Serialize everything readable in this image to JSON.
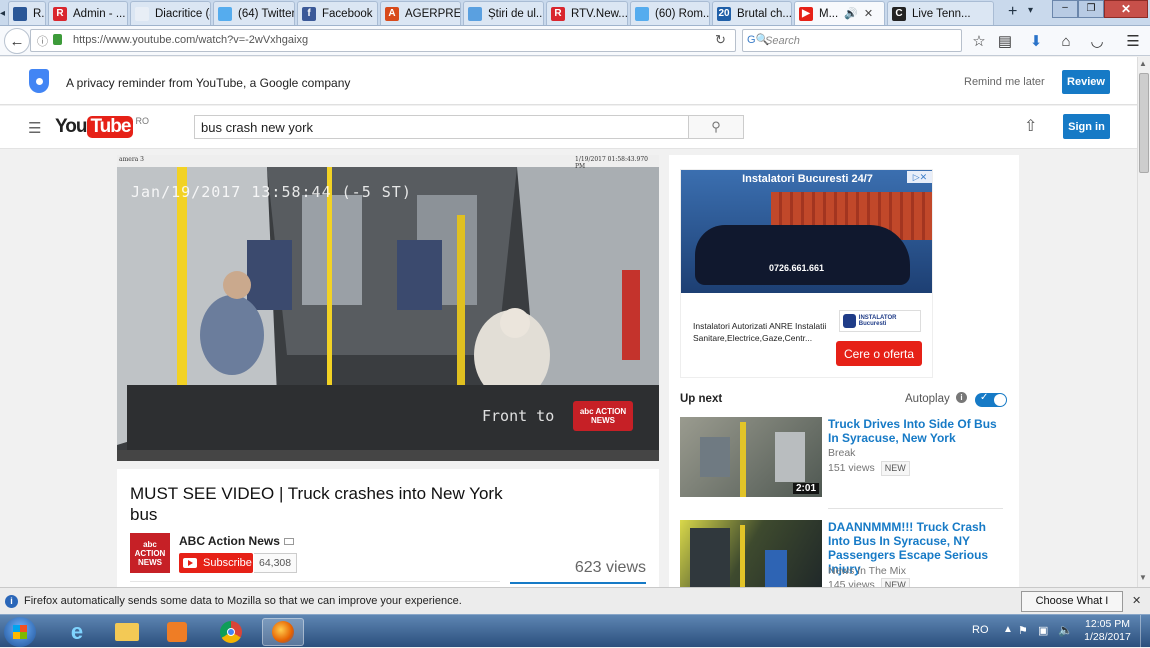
{
  "browser": {
    "tabs": [
      {
        "label": "R...",
        "icon": "generic-tab-icon",
        "color": "#2b5797",
        "glyph": ""
      },
      {
        "label": "Admin - ...",
        "icon": "admin-r-icon",
        "color": "#d9262e",
        "glyph": "R"
      },
      {
        "label": "Diacritice (ăâî...",
        "icon": "blank-page-icon",
        "color": "#e8eef6",
        "glyph": ""
      },
      {
        "label": "(64) Twitter",
        "icon": "twitter-icon",
        "color": "#55acee",
        "glyph": ""
      },
      {
        "label": "Facebook",
        "icon": "facebook-icon",
        "color": "#3b5998",
        "glyph": "f"
      },
      {
        "label": "AGERPRE...",
        "icon": "agerpres-icon",
        "color": "#d84a1b",
        "glyph": "A"
      },
      {
        "label": "Știri de ul...",
        "icon": "news-icon",
        "color": "#5aa0e0",
        "glyph": ""
      },
      {
        "label": "RTV.New...",
        "icon": "rtv-icon",
        "color": "#d9262e",
        "glyph": "R"
      },
      {
        "label": "(60) Rom...",
        "icon": "twitter-icon",
        "color": "#55acee",
        "glyph": ""
      },
      {
        "label": "Brutal ch...",
        "icon": "twenty-icon",
        "color": "#1f5fa8",
        "glyph": "20"
      },
      {
        "label": "M...",
        "icon": "youtube-tab-icon",
        "color": "#e62117",
        "glyph": "▶"
      },
      {
        "label": "Live Tenn...",
        "icon": "tennis-icon",
        "color": "#222222",
        "glyph": "C"
      }
    ],
    "url": "https://www.youtube.com/watch?v=-2wVxhgaixg",
    "search_placeholder": "Search"
  },
  "privacy": {
    "text": "A privacy reminder from YouTube, a Google company",
    "remind": "Remind me later",
    "review": "Review"
  },
  "youtube": {
    "logo_you": "You",
    "logo_tube": "Tube",
    "region": "RO",
    "search_query": "bus crash new york",
    "signin": "Sign in"
  },
  "video": {
    "overlay_time": "Jan/19/2017 13:58:44 (-5 ST)",
    "camera": "amera 3",
    "stamp": "1/19/2017 01:58:43.970 PM",
    "watermark": "Front to",
    "badge": "abc ACTION NEWS",
    "title": "MUST SEE VIDEO | Truck crashes into New York bus",
    "channel": "ABC Action News",
    "channel_logo": "abc ACTION NEWS",
    "subscribe": "Subscribe",
    "subscribers": "64,308",
    "views": "623 views"
  },
  "ad": {
    "banner_title": "Instalatori Bucuresti 24/7",
    "phone": "0726.661.661",
    "text": "Instalatori Autorizati ANRE Instalatii Sanitare,Electrice,Gaze,Centr...",
    "logo": "INSTALATOR Bucuresti",
    "cta": "Cere o oferta"
  },
  "upnext": {
    "label": "Up next",
    "autoplay": "Autoplay",
    "items": [
      {
        "title": "Truck Drives Into Side Of Bus In Syracuse, New York",
        "channel": "Break",
        "views": "151 views",
        "badge": "NEW",
        "duration": "2:01"
      },
      {
        "title": "DAANNMMM!!! Truck Crash Into Bus In Syracuse, NY Passengers Escape Serious Injury",
        "channel": "News In The Mix",
        "views": "145 views",
        "badge": "NEW",
        "duration": ""
      }
    ]
  },
  "notification": {
    "text": "Firefox automatically sends some data to Mozilla so that we can improve your experience.",
    "button": "Choose What I Share"
  },
  "taskbar": {
    "lang": "RO",
    "time": "12:05 PM",
    "date": "1/28/2017"
  }
}
